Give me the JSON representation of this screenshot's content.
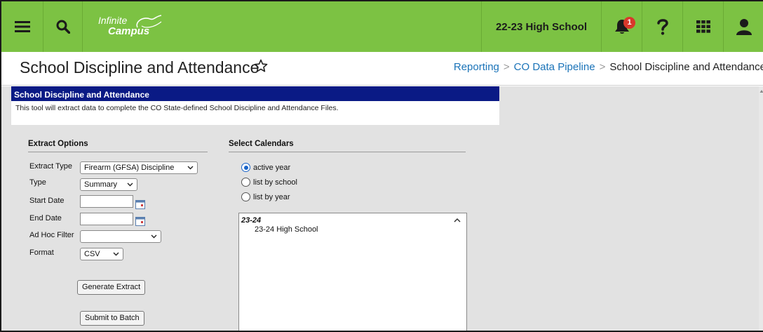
{
  "topbar": {
    "menu_icon": "hamburger-menu-icon",
    "search_icon": "search-icon",
    "logo_line1": "Infinite",
    "logo_line2": "Campus",
    "school": "22-23 High School",
    "notification_icon": "bell-icon",
    "notification_count": "1",
    "help_icon": "question-mark-icon",
    "apps_icon": "app-grid-icon",
    "user_icon": "user-icon",
    "color": "#7cc243"
  },
  "title": {
    "text": "School Discipline and Attendance",
    "star_icon": "star-outline-icon"
  },
  "breadcrumb": {
    "items": [
      "Reporting",
      "CO Data Pipeline",
      "School Discipline and Attendance"
    ],
    "separator": ">"
  },
  "panel": {
    "header": "School Discipline and Attendance",
    "header_color": "#0a1a85",
    "description": "This tool will extract data to complete the CO State-defined School Discipline and Attendance Files."
  },
  "extract_options": {
    "title": "Extract Options",
    "extract_type_label": "Extract Type",
    "extract_type_value": "Firearm (GFSA) Discipline",
    "type_label": "Type",
    "type_value": "Summary",
    "start_date_label": "Start Date",
    "start_date_value": "",
    "end_date_label": "End Date",
    "end_date_value": "",
    "adhoc_label": "Ad Hoc Filter",
    "adhoc_value": "",
    "format_label": "Format",
    "format_value": "CSV",
    "generate_button": "Generate Extract",
    "batch_button": "Submit to Batch"
  },
  "calendars": {
    "title": "Select Calendars",
    "options": [
      {
        "label": "active year",
        "selected": true
      },
      {
        "label": "list by school",
        "selected": false
      },
      {
        "label": "list by year",
        "selected": false
      }
    ],
    "group": "23-24",
    "items": [
      "23-24 High School"
    ]
  }
}
